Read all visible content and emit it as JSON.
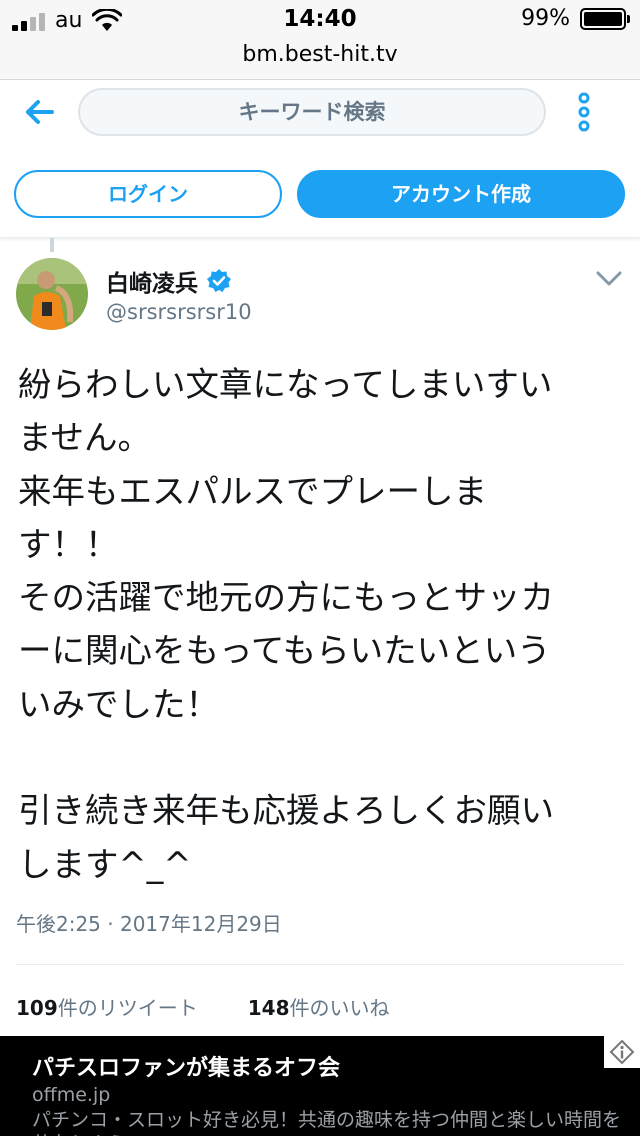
{
  "status_bar": {
    "carrier": "au",
    "time": "14:40",
    "battery_percent": "99%",
    "battery_level": 0.99,
    "signal_bars_on": 2,
    "signal_bars_total": 4
  },
  "url_bar": {
    "domain": "bm.best-hit.tv"
  },
  "header": {
    "back_icon": "arrow-left-icon",
    "search_placeholder": "キーワード検索",
    "more_icon": "more-vertical-icon"
  },
  "auth": {
    "login_label": "ログイン",
    "signup_label": "アカウント作成"
  },
  "tweet": {
    "author_name": "白崎凌兵",
    "handle": "@srsrsrsrsr10",
    "verified": true,
    "text_lines": [
      "紛らわしい文章になってしまいすい",
      "ません。",
      "来年もエスパルスでプレーしま",
      "す！！",
      "その活躍で地元の方にもっとサッカ",
      "ーに関心をもってもらいたいという",
      "いみでした！",
      "",
      "引き続き来年も応援よろしくお願い",
      "します^_^"
    ],
    "timestamp": "午後2:25 · 2017年12月29日",
    "retweet_count": "109",
    "retweet_label": "件のリツイート",
    "like_count": "148",
    "like_label": "件のいいね"
  },
  "ad": {
    "title": "パチスロファンが集まるオフ会",
    "domain": "offme.jp",
    "description": "パチンコ・スロット好き必見！共通の趣味を持つ仲間と楽しい時間を共有しよう",
    "info_icon": "ad-info-icon"
  },
  "colors": {
    "accent": "#1da1f2",
    "text": "#14171a",
    "muted": "#657786"
  }
}
